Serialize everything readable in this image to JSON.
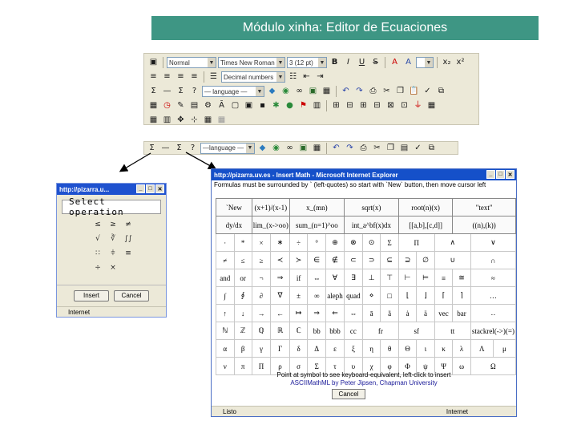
{
  "title": "Módulo xinha: Editor de Ecuaciones",
  "toolbar": {
    "style_value": "Normal",
    "font_value": "Times New Roman",
    "size_value": "3 (12 pt)",
    "list_value": "Decimal numbers",
    "language_value": "— language —",
    "bold": "B",
    "italic": "I",
    "underline": "U",
    "strike": "S",
    "fore_color": "A",
    "back_color": "A",
    "subscript": "x₂",
    "superscript": "x²",
    "sigma": "Σ",
    "dash": "—",
    "help": "?"
  },
  "mini_toolbar": {
    "sigma": "Σ",
    "dash": "—",
    "help": "?",
    "language_value": "—language —"
  },
  "popup": {
    "title": "http://pizarra.u...",
    "heading": "Select operation",
    "ops": [
      "≤",
      "≥",
      "≠",
      "√",
      "∛",
      "∫∫",
      "∷",
      "⫩",
      "≡",
      "÷",
      "×",
      ""
    ],
    "insert": "Insert",
    "cancel": "Cancel",
    "status": "Internet"
  },
  "ie": {
    "title": "http://pizarra.uv.es - Insert Math - Microsoft Internet Explorer",
    "instructions": "Formulas must be surrounded by ` (left-quotes) so start with `New` button, then move cursor left",
    "rows": [
      [
        "`New",
        "(x+1)/(x-1)",
        "x_(mn)",
        "sqrt(x)",
        "root(n)(x)",
        "\"text\""
      ],
      [
        "dy/dx",
        "lim_(x->oo)",
        "sum_(n=1)^oo",
        "int_a^bf(x)dx",
        "[[a,b],[c,d]]",
        "((n),(k))"
      ],
      [
        "·",
        "*",
        "×",
        "∗",
        "÷",
        "°",
        "⊕",
        "⊗",
        "⊙",
        "Σ",
        "Π",
        "∧",
        "∨"
      ],
      [
        "≠",
        "≤",
        "≥",
        "≺",
        "≻",
        "∈",
        "∉",
        "⊂",
        "⊃",
        "⊆",
        "⊇",
        "∅",
        "∪",
        "∩"
      ],
      [
        "and",
        "or",
        "¬",
        "⇒",
        "if",
        "⇔",
        "∀",
        "∃",
        "⊥",
        "⊤",
        "⊢",
        "⊨",
        "≡",
        "≅",
        "≈"
      ],
      [
        "∫",
        "∮",
        "∂",
        "∇",
        "±",
        "∞",
        "aleph",
        "quad",
        "⋄",
        "□",
        "⌊",
        "⌋",
        "⌈",
        "⌉",
        "…"
      ],
      [
        "↑",
        "↓",
        "→",
        "←",
        "↦",
        "⇒",
        "⇐",
        "⇔",
        "ā",
        "ã",
        "ȧ",
        "ä",
        "vec",
        "bar",
        "‥"
      ],
      [
        "ℕ",
        "ℤ",
        "ℚ",
        "ℝ",
        "ℂ",
        "bb",
        "bbb",
        "cc",
        "fr",
        "sf",
        "tt",
        "stackrel(->)(=)"
      ],
      [
        "α",
        "β",
        "γ",
        "Γ",
        "δ",
        "Δ",
        "ε",
        "ξ",
        "η",
        "θ",
        "Θ",
        "ι",
        "κ",
        "λ",
        "Λ",
        "μ"
      ],
      [
        "ν",
        "π",
        "Π",
        "ρ",
        "σ",
        "Σ",
        "τ",
        "υ",
        "χ",
        "φ",
        "Φ",
        "ψ",
        "Ψ",
        "ω",
        "Ω"
      ]
    ],
    "footer_line1": "Point at symbol to see keyboard-equivalent, left-click to insert",
    "footer_line2": "ASCIIMathML by Peter Jipsen, Chapman University",
    "cancel": "Cancel",
    "status": "Listo",
    "status_zone": "Internet"
  },
  "colors": {
    "title_bg": "#3e9684",
    "toolbar_bg": "#ece9d8",
    "xp_blue": "#1f52cf"
  }
}
